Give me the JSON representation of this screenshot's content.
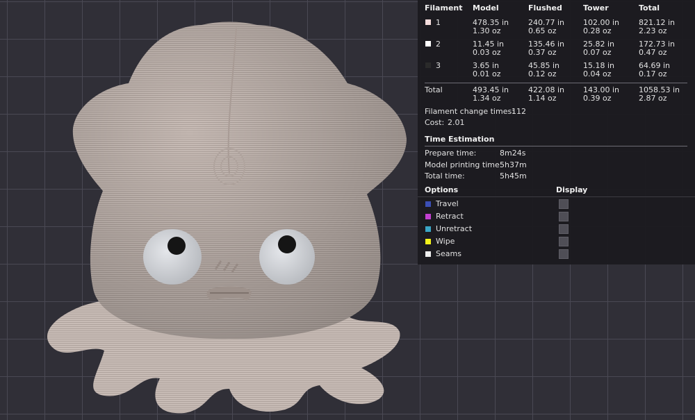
{
  "table": {
    "headers": [
      "Filament",
      "Model",
      "Flushed",
      "Tower",
      "Total"
    ],
    "rows": [
      {
        "id": "1",
        "color": "#f4dcdc",
        "model": [
          "478.35 in",
          "1.30 oz"
        ],
        "flushed": [
          "240.77 in",
          "0.65 oz"
        ],
        "tower": [
          "102.00 in",
          "0.28 oz"
        ],
        "total": [
          "821.12 in",
          "2.23 oz"
        ]
      },
      {
        "id": "2",
        "color": "#ffffff",
        "model": [
          "11.45 in",
          "0.03 oz"
        ],
        "flushed": [
          "135.46 in",
          "0.37 oz"
        ],
        "tower": [
          "25.82 in",
          "0.07 oz"
        ],
        "total": [
          "172.73 in",
          "0.47 oz"
        ]
      },
      {
        "id": "3",
        "color": "#2a2a2a",
        "model": [
          "3.65 in",
          "0.01 oz"
        ],
        "flushed": [
          "45.85 in",
          "0.12 oz"
        ],
        "tower": [
          "15.18 in",
          "0.04 oz"
        ],
        "total": [
          "64.69 in",
          "0.17 oz"
        ]
      }
    ],
    "total": {
      "label": "Total",
      "model": [
        "493.45 in",
        "1.34 oz"
      ],
      "flushed": [
        "422.08 in",
        "1.14 oz"
      ],
      "tower": [
        "143.00 in",
        "0.39 oz"
      ],
      "total": [
        "1058.53 in",
        "2.87 oz"
      ]
    }
  },
  "summary": {
    "change_label": "Filament change times:",
    "change_value": "112",
    "cost_label": "Cost:",
    "cost_value": "2.01"
  },
  "time": {
    "title": "Time Estimation",
    "items": [
      {
        "label": "Prepare time:",
        "value": "8m24s"
      },
      {
        "label": "Model printing time:",
        "value": "5h37m"
      },
      {
        "label": "Total time:",
        "value": "5h45m"
      }
    ]
  },
  "options": {
    "title": "Options",
    "display_title": "Display",
    "items": [
      {
        "label": "Travel",
        "color": "#3b4fb5"
      },
      {
        "label": "Retract",
        "color": "#c23fd0"
      },
      {
        "label": "Unretract",
        "color": "#3aa6c6"
      },
      {
        "label": "Wipe",
        "color": "#f2f21b"
      },
      {
        "label": "Seams",
        "color": "#eeeeee"
      }
    ]
  }
}
